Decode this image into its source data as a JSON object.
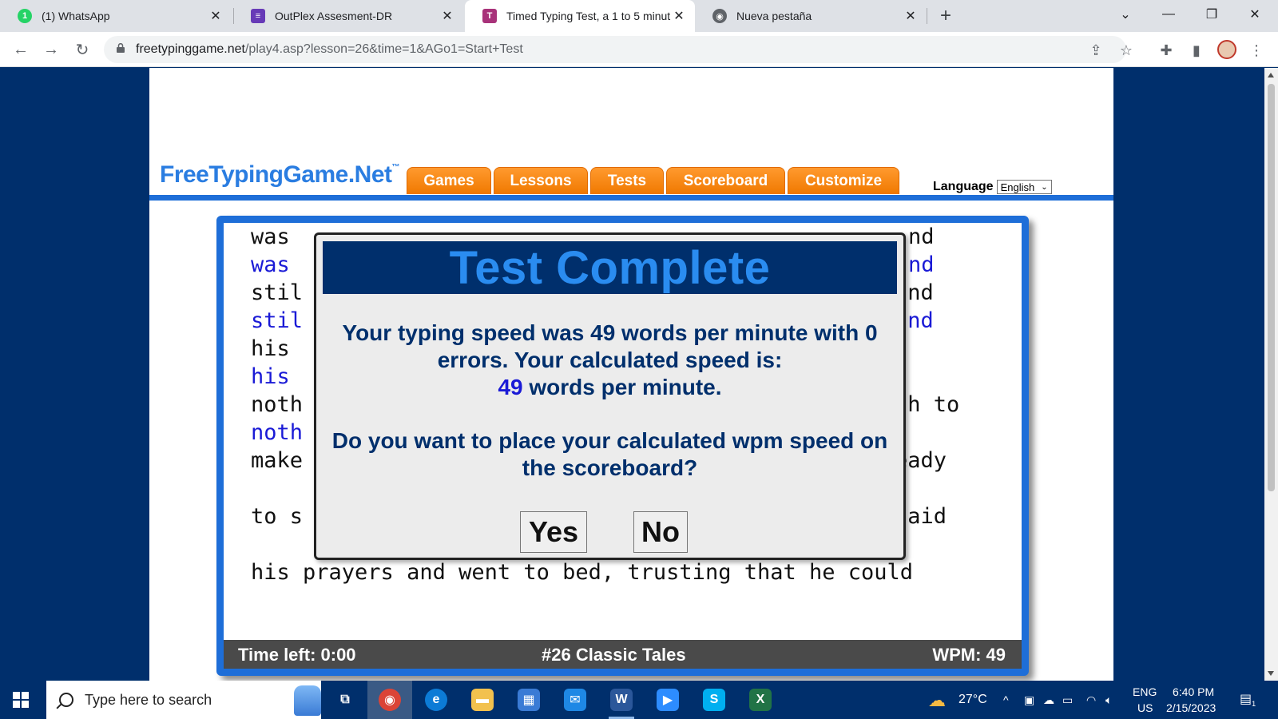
{
  "browser": {
    "tabs": [
      {
        "title": "(1) WhatsApp",
        "favicon": "whatsapp-icon",
        "favicon_char": "1",
        "color": "#25d366",
        "active": false
      },
      {
        "title": "OutPlex Assesment-DR",
        "favicon": "forms-icon",
        "favicon_char": "≡",
        "color": "#673ab7",
        "active": false
      },
      {
        "title": "Timed Typing Test, a 1 to 5 minut",
        "favicon": "typing-icon",
        "favicon_char": "T",
        "color": "#a8327a",
        "active": true
      },
      {
        "title": "Nueva pestaña",
        "favicon": "chrome-icon",
        "favicon_char": "◉",
        "color": "#5f6368",
        "active": false
      }
    ],
    "url_host": "freetypinggame.net",
    "url_path": "/play4.asp?lesson=26&time=1&AGo1=Start+Test"
  },
  "site": {
    "logo": "FreeTypingGame.Net",
    "logo_tm": "™",
    "nav": [
      "Games",
      "Lessons",
      "Tests",
      "Scoreboard",
      "Customize"
    ],
    "language_label": "Language",
    "language_value": "English",
    "brand_blue": "#1e6ed8",
    "tab_orange": "#f58a1f"
  },
  "typing": {
    "lines": [
      {
        "text": "was ",
        "right": "nd",
        "typed": false
      },
      {
        "text": "was ",
        "right": "nd",
        "typed": true
      },
      {
        "text": "stil",
        "right": "and",
        "typed": false
      },
      {
        "text": "stil",
        "right": "and",
        "typed": true
      },
      {
        "text": "his ",
        "right": "",
        "typed": false
      },
      {
        "text": "his ",
        "right": "",
        "typed": true
      },
      {
        "text": "noth",
        "right": "gh to",
        "typed": false
      },
      {
        "text": "noth",
        "right": "",
        "typed": true
      },
      {
        "text": "make",
        "right": "eady",
        "typed": false
      },
      {
        "text": "",
        "right": "",
        "typed": false
      },
      {
        "text": "to s",
        "right": "said",
        "typed": false
      },
      {
        "text": "",
        "right": "",
        "typed": false
      },
      {
        "text": "his prayers and went to bed, trusting that he could",
        "right": "",
        "typed": false
      }
    ],
    "time_left": "Time left: 0:00",
    "lesson": "#26 Classic Tales",
    "wpm": "WPM: 49"
  },
  "modal": {
    "title": "Test Complete",
    "line1": "Your typing speed was 49 words per minute with 0",
    "line2": "errors. Your calculated speed is:",
    "speed": "49",
    "speed_unit": " words per minute.",
    "question1": "Do you want to place your calculated wpm speed on",
    "question2": "the scoreboard?",
    "yes": "Yes",
    "no": "No"
  },
  "taskbar": {
    "search_placeholder": "Type here to search",
    "apps": [
      {
        "name": "task-view-icon",
        "char": "⧉",
        "color": "transparent"
      },
      {
        "name": "chrome-icon",
        "char": "◉",
        "color": "#db4437",
        "active": true
      },
      {
        "name": "edge-icon",
        "char": "e",
        "color": "#0c7bd6"
      },
      {
        "name": "file-explorer-icon",
        "char": "▬",
        "color": "#f2c14e"
      },
      {
        "name": "store-icon",
        "char": "▦",
        "color": "#3a7bd5"
      },
      {
        "name": "mail-icon",
        "char": "✉",
        "color": "#1e88e5"
      },
      {
        "name": "word-icon",
        "char": "W",
        "color": "#2b579a",
        "active_line": true
      },
      {
        "name": "zoom-icon",
        "char": "▶",
        "color": "#2d8cff"
      },
      {
        "name": "skype-icon",
        "char": "S",
        "color": "#00aff0"
      },
      {
        "name": "excel-icon",
        "char": "X",
        "color": "#217346"
      }
    ],
    "temperature": "27°C",
    "lang_top": "ENG",
    "lang_bottom": "US",
    "time": "6:40 PM",
    "date": "2/15/2023",
    "notifications": "1"
  }
}
